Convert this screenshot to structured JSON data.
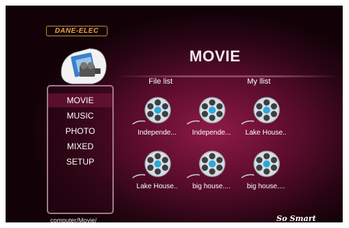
{
  "brand": "DANE-ELEC",
  "app_icon": "film-folder-icon",
  "title": "MOVIE",
  "menu": [
    {
      "label": "MOVIE",
      "active": true
    },
    {
      "label": "MUSIC",
      "active": false
    },
    {
      "label": "PHOTO",
      "active": false
    },
    {
      "label": "MIXED",
      "active": false
    },
    {
      "label": "SETUP",
      "active": false
    }
  ],
  "columns": {
    "file_list": "File list",
    "my_list": "My llist"
  },
  "items": [
    {
      "label": "Independe...",
      "icon": "film-reel-icon"
    },
    {
      "label": "Independe...",
      "icon": "film-reel-icon"
    },
    {
      "label": "Lake House..",
      "icon": "film-reel-icon"
    },
    {
      "label": "Lake House..",
      "icon": "film-reel-icon"
    },
    {
      "label": "big house....",
      "icon": "film-reel-icon"
    },
    {
      "label": "big house....",
      "icon": "film-reel-icon"
    }
  ],
  "path": "computer/Movie/",
  "tagline": "So Smart",
  "colors": {
    "accent": "#8e1a48",
    "background": "#2a0514",
    "brand": "#e6a24a",
    "reel": "#d8dde2"
  }
}
